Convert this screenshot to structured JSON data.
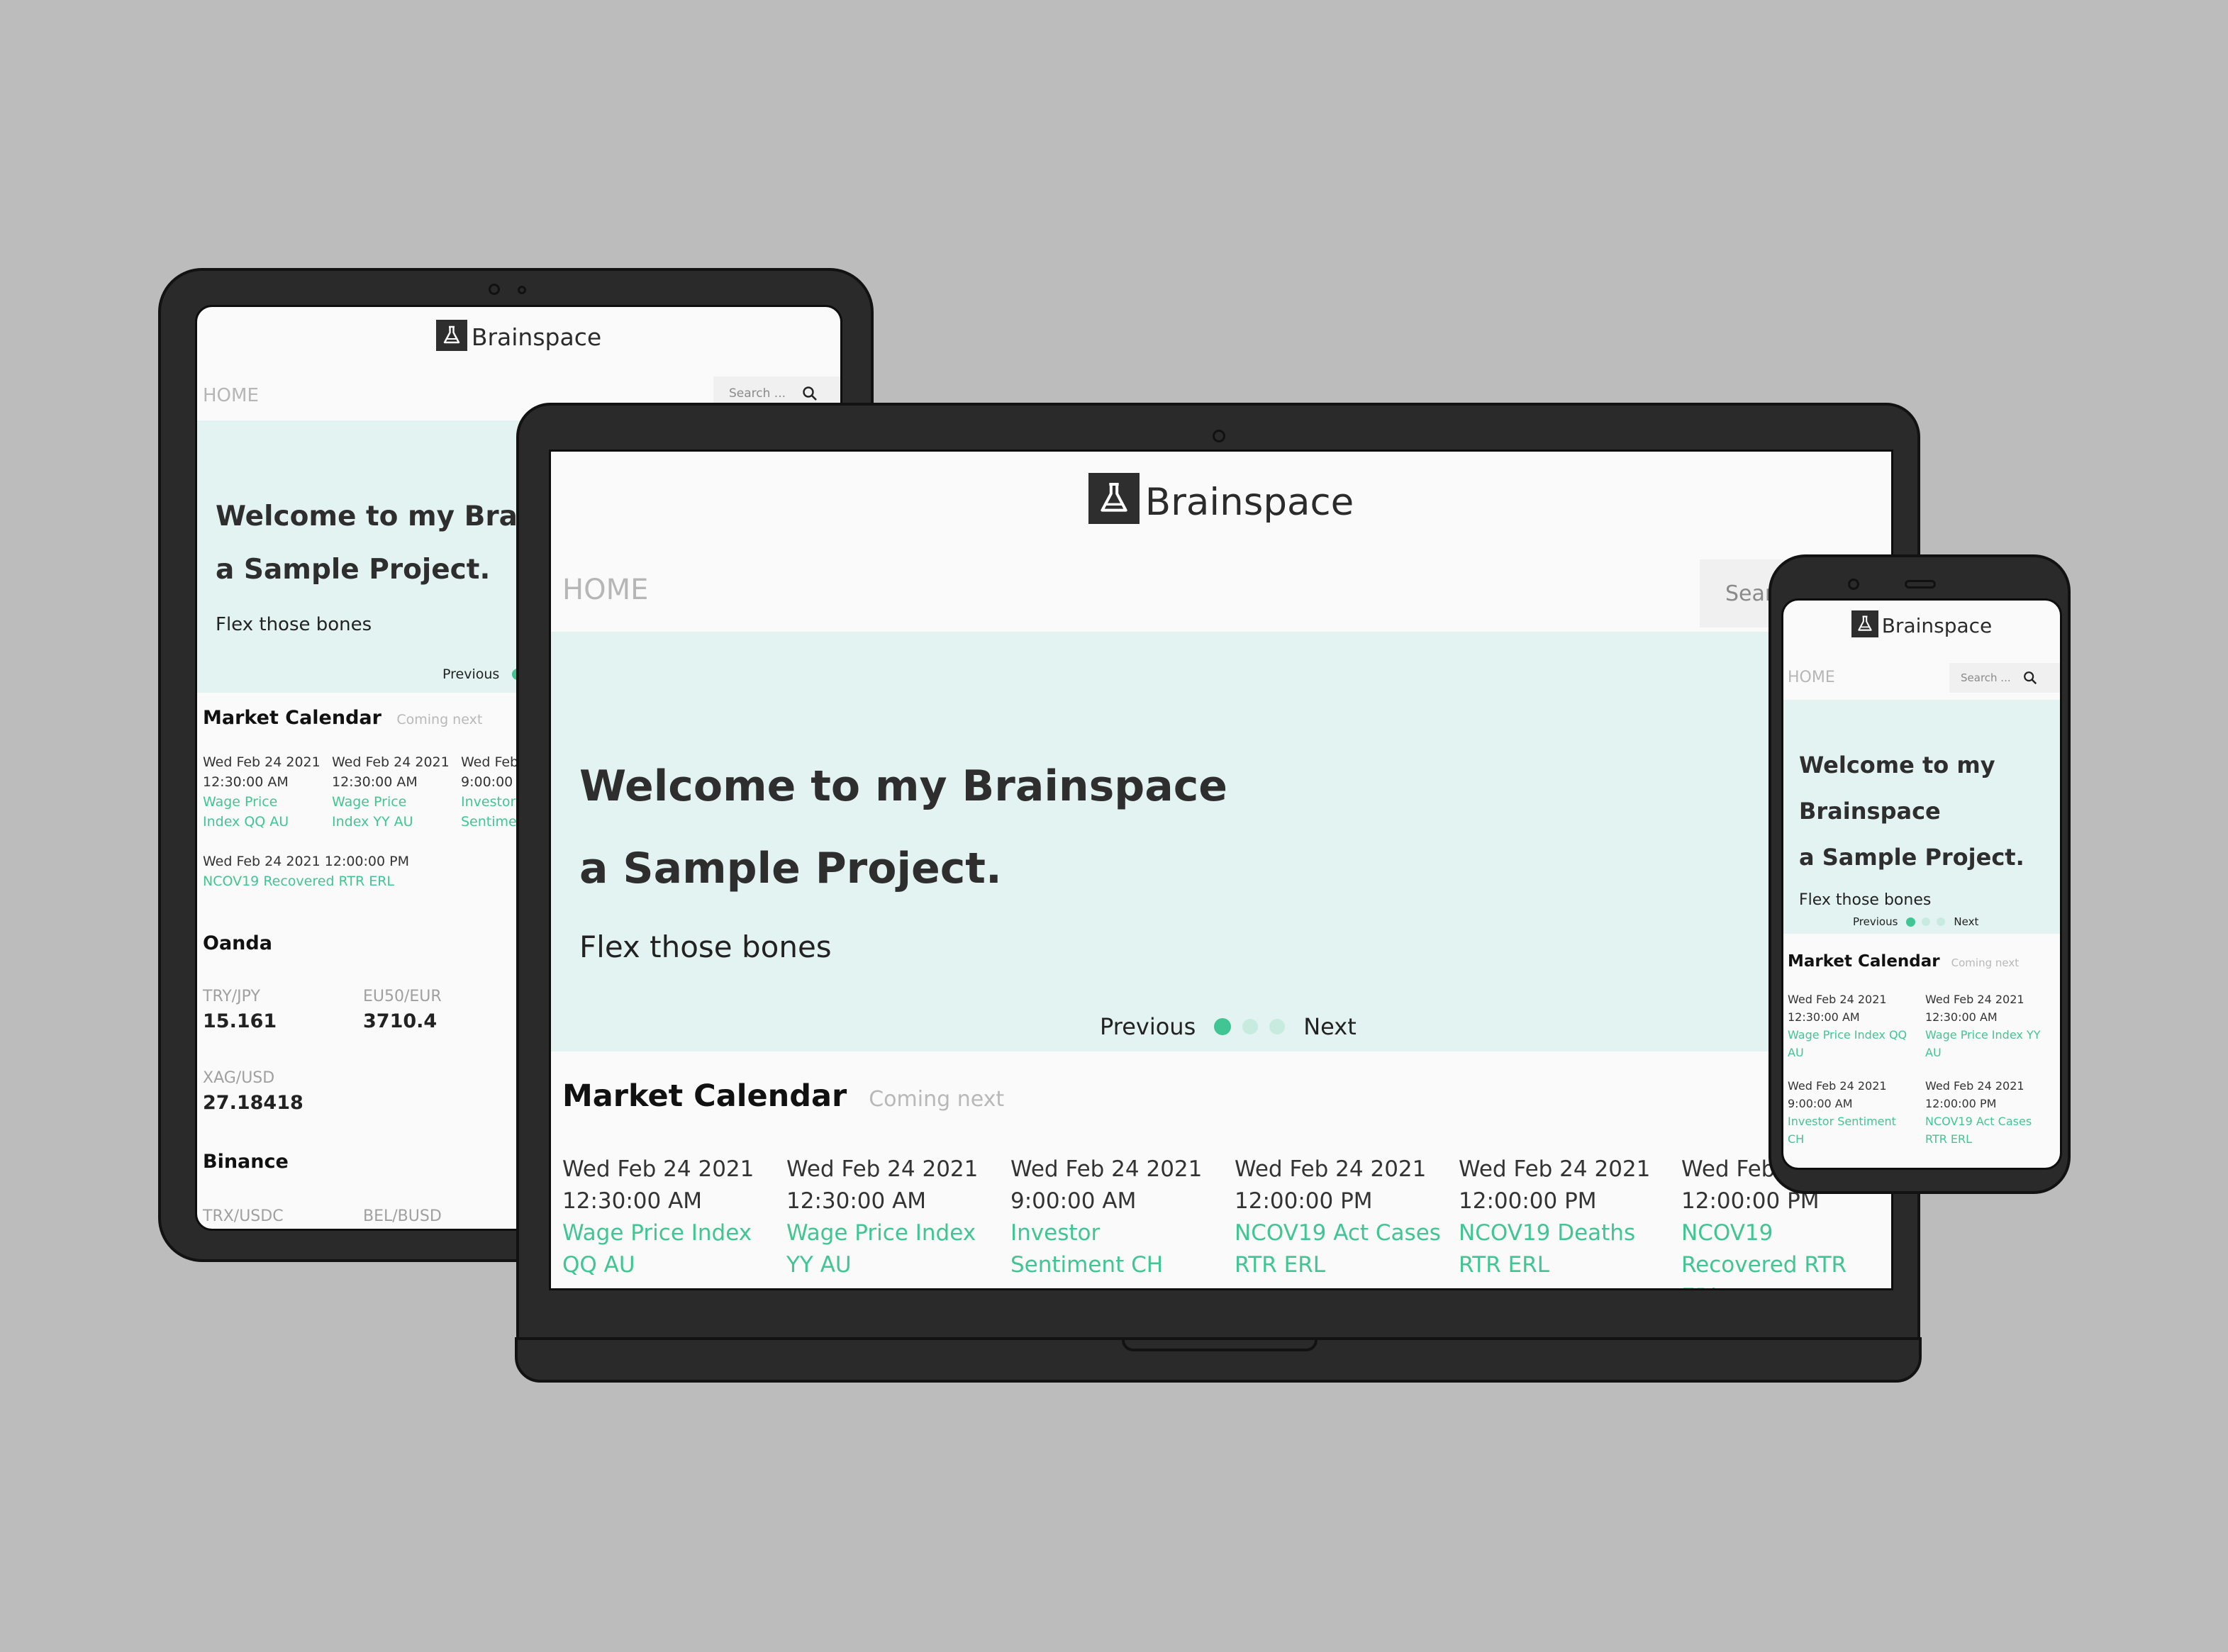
{
  "brand": "Brainspace",
  "nav_home": "HOME",
  "search_placeholder": "Search ...",
  "search_laptop_visible": "Sear",
  "hero": {
    "title_line1": "Welcome to my Brainspace",
    "title_line2": "a Sample Project.",
    "tablet_line1": "Welcome to my Brains",
    "mobile_line1": "Welcome to my",
    "mobile_line2": "Brainspace",
    "subtitle": "Flex those bones",
    "prev": "Previous",
    "next": "Next"
  },
  "calendar": {
    "title": "Market Calendar",
    "subtitle": "Coming next",
    "events": [
      {
        "date": "Wed Feb 24 2021",
        "time": "12:30:00 AM",
        "name": "Wage Price Index QQ AU"
      },
      {
        "date": "Wed Feb 24 2021",
        "time": "12:30:00 AM",
        "name": "Wage Price Index YY AU"
      },
      {
        "date": "Wed Feb 24 2021",
        "time": "9:00:00 AM",
        "name": "Investor Sentiment CH"
      },
      {
        "date": "Wed Feb 24 2021",
        "time": "12:00:00 PM",
        "name": "NCOV19 Act Cases RTR ERL"
      },
      {
        "date": "Wed Feb 24 2021",
        "time": "12:00:00 PM",
        "name": "NCOV19 Deaths RTR ERL"
      },
      {
        "date": "Wed Feb 24 2021",
        "time": "12:00:00 PM",
        "name": "NCOV19 Recovered RTR ERL"
      }
    ],
    "laptop_cut_date": "Wed Feb",
    "tablet_cut": {
      "date": "Wed Feb",
      "time": "9:00:00 A",
      "name1": "Investor",
      "name2": "Sentime"
    }
  },
  "oanda": {
    "title": "Oanda",
    "pairs": [
      {
        "pair": "TRY/JPY",
        "price": "15.161"
      },
      {
        "pair": "EU50/EUR",
        "price": "3710.4"
      },
      {
        "pair": "XAG/USD",
        "price": "27.18418"
      }
    ]
  },
  "binance": {
    "title": "Binance",
    "pairs": [
      {
        "pair": "TRX/USDC"
      },
      {
        "pair": "BEL/BUSD"
      }
    ]
  },
  "colors": {
    "background": "#bcbcbc",
    "device_body": "#2b2a2b",
    "screen": "#fafafa",
    "hero": "#e2f3f2",
    "accent": "#41c595",
    "dot_inactive": "#c8ebe0"
  },
  "icons": {
    "logo": "flask-icon",
    "search": "search-icon",
    "camera": "camera-icon"
  }
}
